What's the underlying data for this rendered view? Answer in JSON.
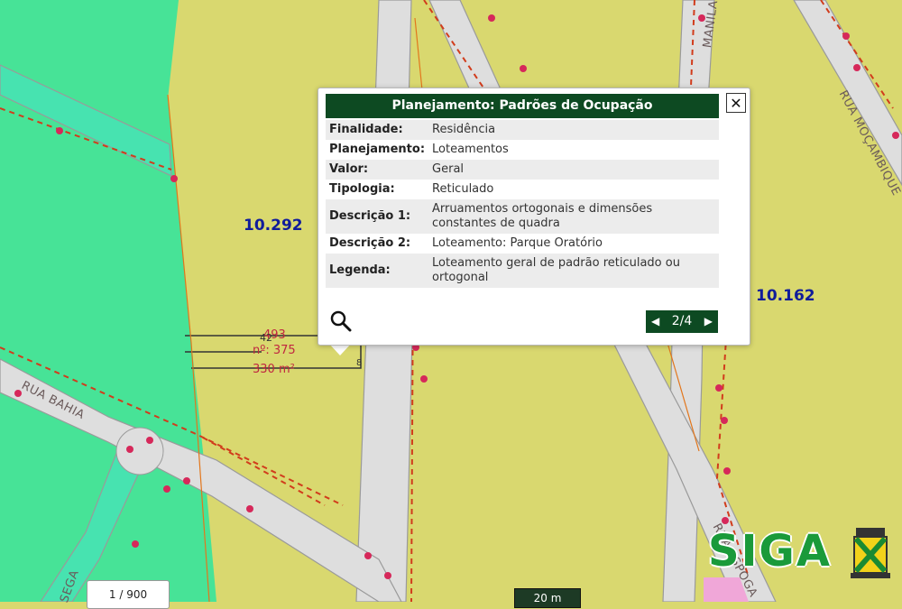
{
  "popup": {
    "title": "Planejamento: Padrões de Ocupação",
    "close_label": "✕",
    "rows": [
      {
        "key": "Finalidade:",
        "value": "Residência"
      },
      {
        "key": "Planejamento:",
        "value": "Loteamentos"
      },
      {
        "key": "Valor:",
        "value": "Geral"
      },
      {
        "key": "Tipologia:",
        "value": "Reticulado"
      },
      {
        "key": "Descrição 1:",
        "value": "Arruamentos ortogonais e dimensões constantes de quadra"
      },
      {
        "key": "Descrição 2:",
        "value": "Loteamento: Parque Oratório"
      },
      {
        "key": "Legenda:",
        "value": "Loteamento geral de padrão reticulado ou ortogonal"
      }
    ],
    "pager": {
      "label": "2/4",
      "prev_icon": "◀",
      "next_icon": "▶"
    },
    "search_icon": "magnifier-icon"
  },
  "map": {
    "blocks": [
      {
        "id": "block-10292",
        "label": "10.292"
      },
      {
        "id": "block-10162",
        "label": "10.162"
      }
    ],
    "lot": {
      "number_a": "493",
      "number_b": "42",
      "address": "nº: 375",
      "area": "330 m²",
      "side": "8"
    },
    "streets": [
      {
        "id": "rua-bahia",
        "label": "RUA BAHIA"
      },
      {
        "id": "rua-mocambique",
        "label": "RUA MOÇAMBIQUE"
      },
      {
        "id": "rua-top",
        "label": "MANILA"
      },
      {
        "id": "rua-bottom-left",
        "label": "SEGA"
      },
      {
        "id": "rua-bottom-right",
        "label": "RUA ESPOGA"
      }
    ],
    "scale_ratio": "1 / 900",
    "scalebar_label": "20 m",
    "colors": {
      "lot_fill": "#d9d86f",
      "green_area": "#47e397",
      "street": "#dedede",
      "parcel_line": "#d13c1c",
      "block_label": "#101c9a"
    }
  },
  "logo": {
    "text": "SIGA"
  }
}
